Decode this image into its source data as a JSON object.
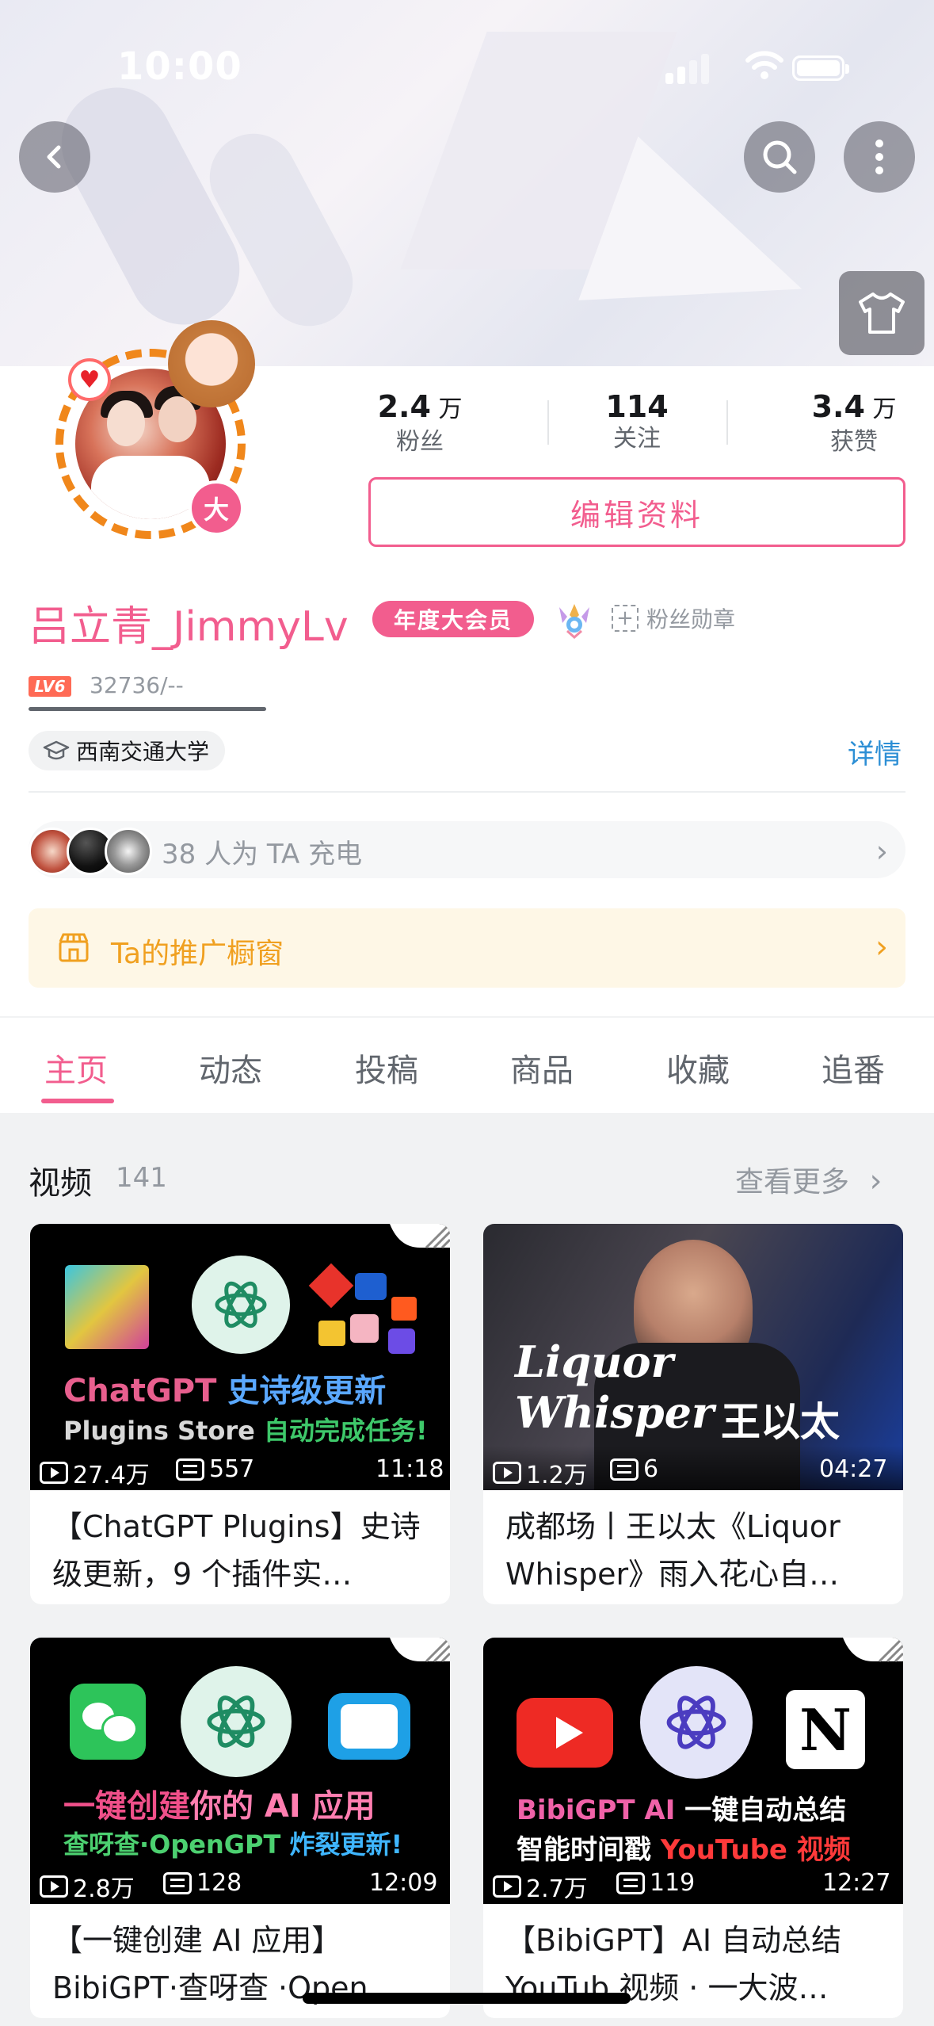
{
  "status_bar": {
    "time": "10:00"
  },
  "profile": {
    "username": "吕立青_JimmyLv",
    "vip_label": "年度大会员",
    "level_badge": "大",
    "level": "LV6",
    "exp": "32736/--",
    "fan_badge_label": "粉丝勋章",
    "school": "西南交通大学",
    "detail_link": "详情",
    "edit_button": "编辑资料",
    "stats": [
      {
        "num": "2.4",
        "unit": "万",
        "label": "粉丝"
      },
      {
        "num": "114",
        "unit": "",
        "label": "关注"
      },
      {
        "num": "3.4",
        "unit": "万",
        "label": "获赞"
      }
    ],
    "charge_text": "38 人为 TA 充电",
    "promo_text": "Ta的推广橱窗"
  },
  "tabs": [
    "主页",
    "动态",
    "投稿",
    "商品",
    "收藏",
    "追番"
  ],
  "active_tab": "主页",
  "videos_section": {
    "title": "视频",
    "count": "141",
    "more": "查看更多"
  },
  "videos": [
    {
      "views": "27.4万",
      "danmaku": "557",
      "duration": "11:18",
      "title": "【ChatGPT Plugins】史诗级更新，9 个插件实…",
      "thumb_line1a": "ChatGPT ",
      "thumb_line1b": "史诗级更新",
      "thumb_line2a": "Plugins Store ",
      "thumb_line2b": "自动完成任务!"
    },
    {
      "views": "1.2万",
      "danmaku": "6",
      "duration": "04:27",
      "title": "成都场丨王以太《Liquor Whisper》雨入花心自…",
      "thumb_line1": "Liquor Whisper",
      "thumb_line2": "王以太"
    },
    {
      "views": "2.8万",
      "danmaku": "128",
      "duration": "12:09",
      "title": "【一键创建 AI 应用】BibiGPT·查呀查 ·Open…",
      "thumb_line1a": "一键创建",
      "thumb_line1b": "你的 AI 应用",
      "thumb_line2a": "查呀查·OpenGPT ",
      "thumb_line2b": "炸裂更新!"
    },
    {
      "views": "2.7万",
      "danmaku": "119",
      "duration": "12:27",
      "title": "【BibiGPT】AI 自动总结 YouTub 视频 · 一大波…",
      "thumb_line1a": "BibiGPT AI ",
      "thumb_line1b": "一键自动总结",
      "thumb_line2a": "智能时间戳 ",
      "thumb_line2b": "YouTube 视频"
    }
  ],
  "colors": {
    "accent": "#f25d8e",
    "link": "#2d8fd5",
    "promo": "#f0a020"
  },
  "icons": [
    "back-icon",
    "search-icon",
    "more-icon",
    "shirt-icon",
    "graduation-cap-icon",
    "shop-icon",
    "chevron-right-icon",
    "play-icon",
    "danmaku-icon"
  ]
}
